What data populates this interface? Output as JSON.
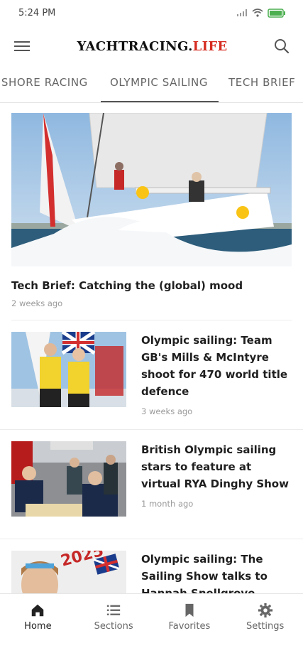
{
  "status": {
    "time": "5:24 PM"
  },
  "appbar": {
    "logo_main": "YACHTRACING.",
    "logo_accent": "LIFE"
  },
  "tabs": [
    {
      "label": "INSHORE RACING"
    },
    {
      "label": "OLYMPIC SAILING"
    },
    {
      "label": "TECH BRIEF"
    }
  ],
  "feature": {
    "title": "Tech Brief: Catching the (global) mood",
    "ago": "2 weeks ago"
  },
  "articles": [
    {
      "title": "Olympic sailing: Team GB's Mills & McIntyre shoot for 470 world title defence",
      "ago": "3 weeks ago"
    },
    {
      "title": "British Olympic sailing stars to feature at virtual RYA Dinghy Show",
      "ago": "1 month ago"
    },
    {
      "title": "Olympic sailing: The Sailing Show talks to Hannah Snellgrove",
      "ago": ""
    }
  ],
  "nav": [
    {
      "label": "Home",
      "icon": "home-icon"
    },
    {
      "label": "Sections",
      "icon": "list-icon"
    },
    {
      "label": "Favorites",
      "icon": "bookmark-icon"
    },
    {
      "label": "Settings",
      "icon": "gear-icon"
    }
  ],
  "colors": {
    "accent_red": "#d62b20",
    "text": "#1f1f1f",
    "muted": "#9a9a9a"
  }
}
